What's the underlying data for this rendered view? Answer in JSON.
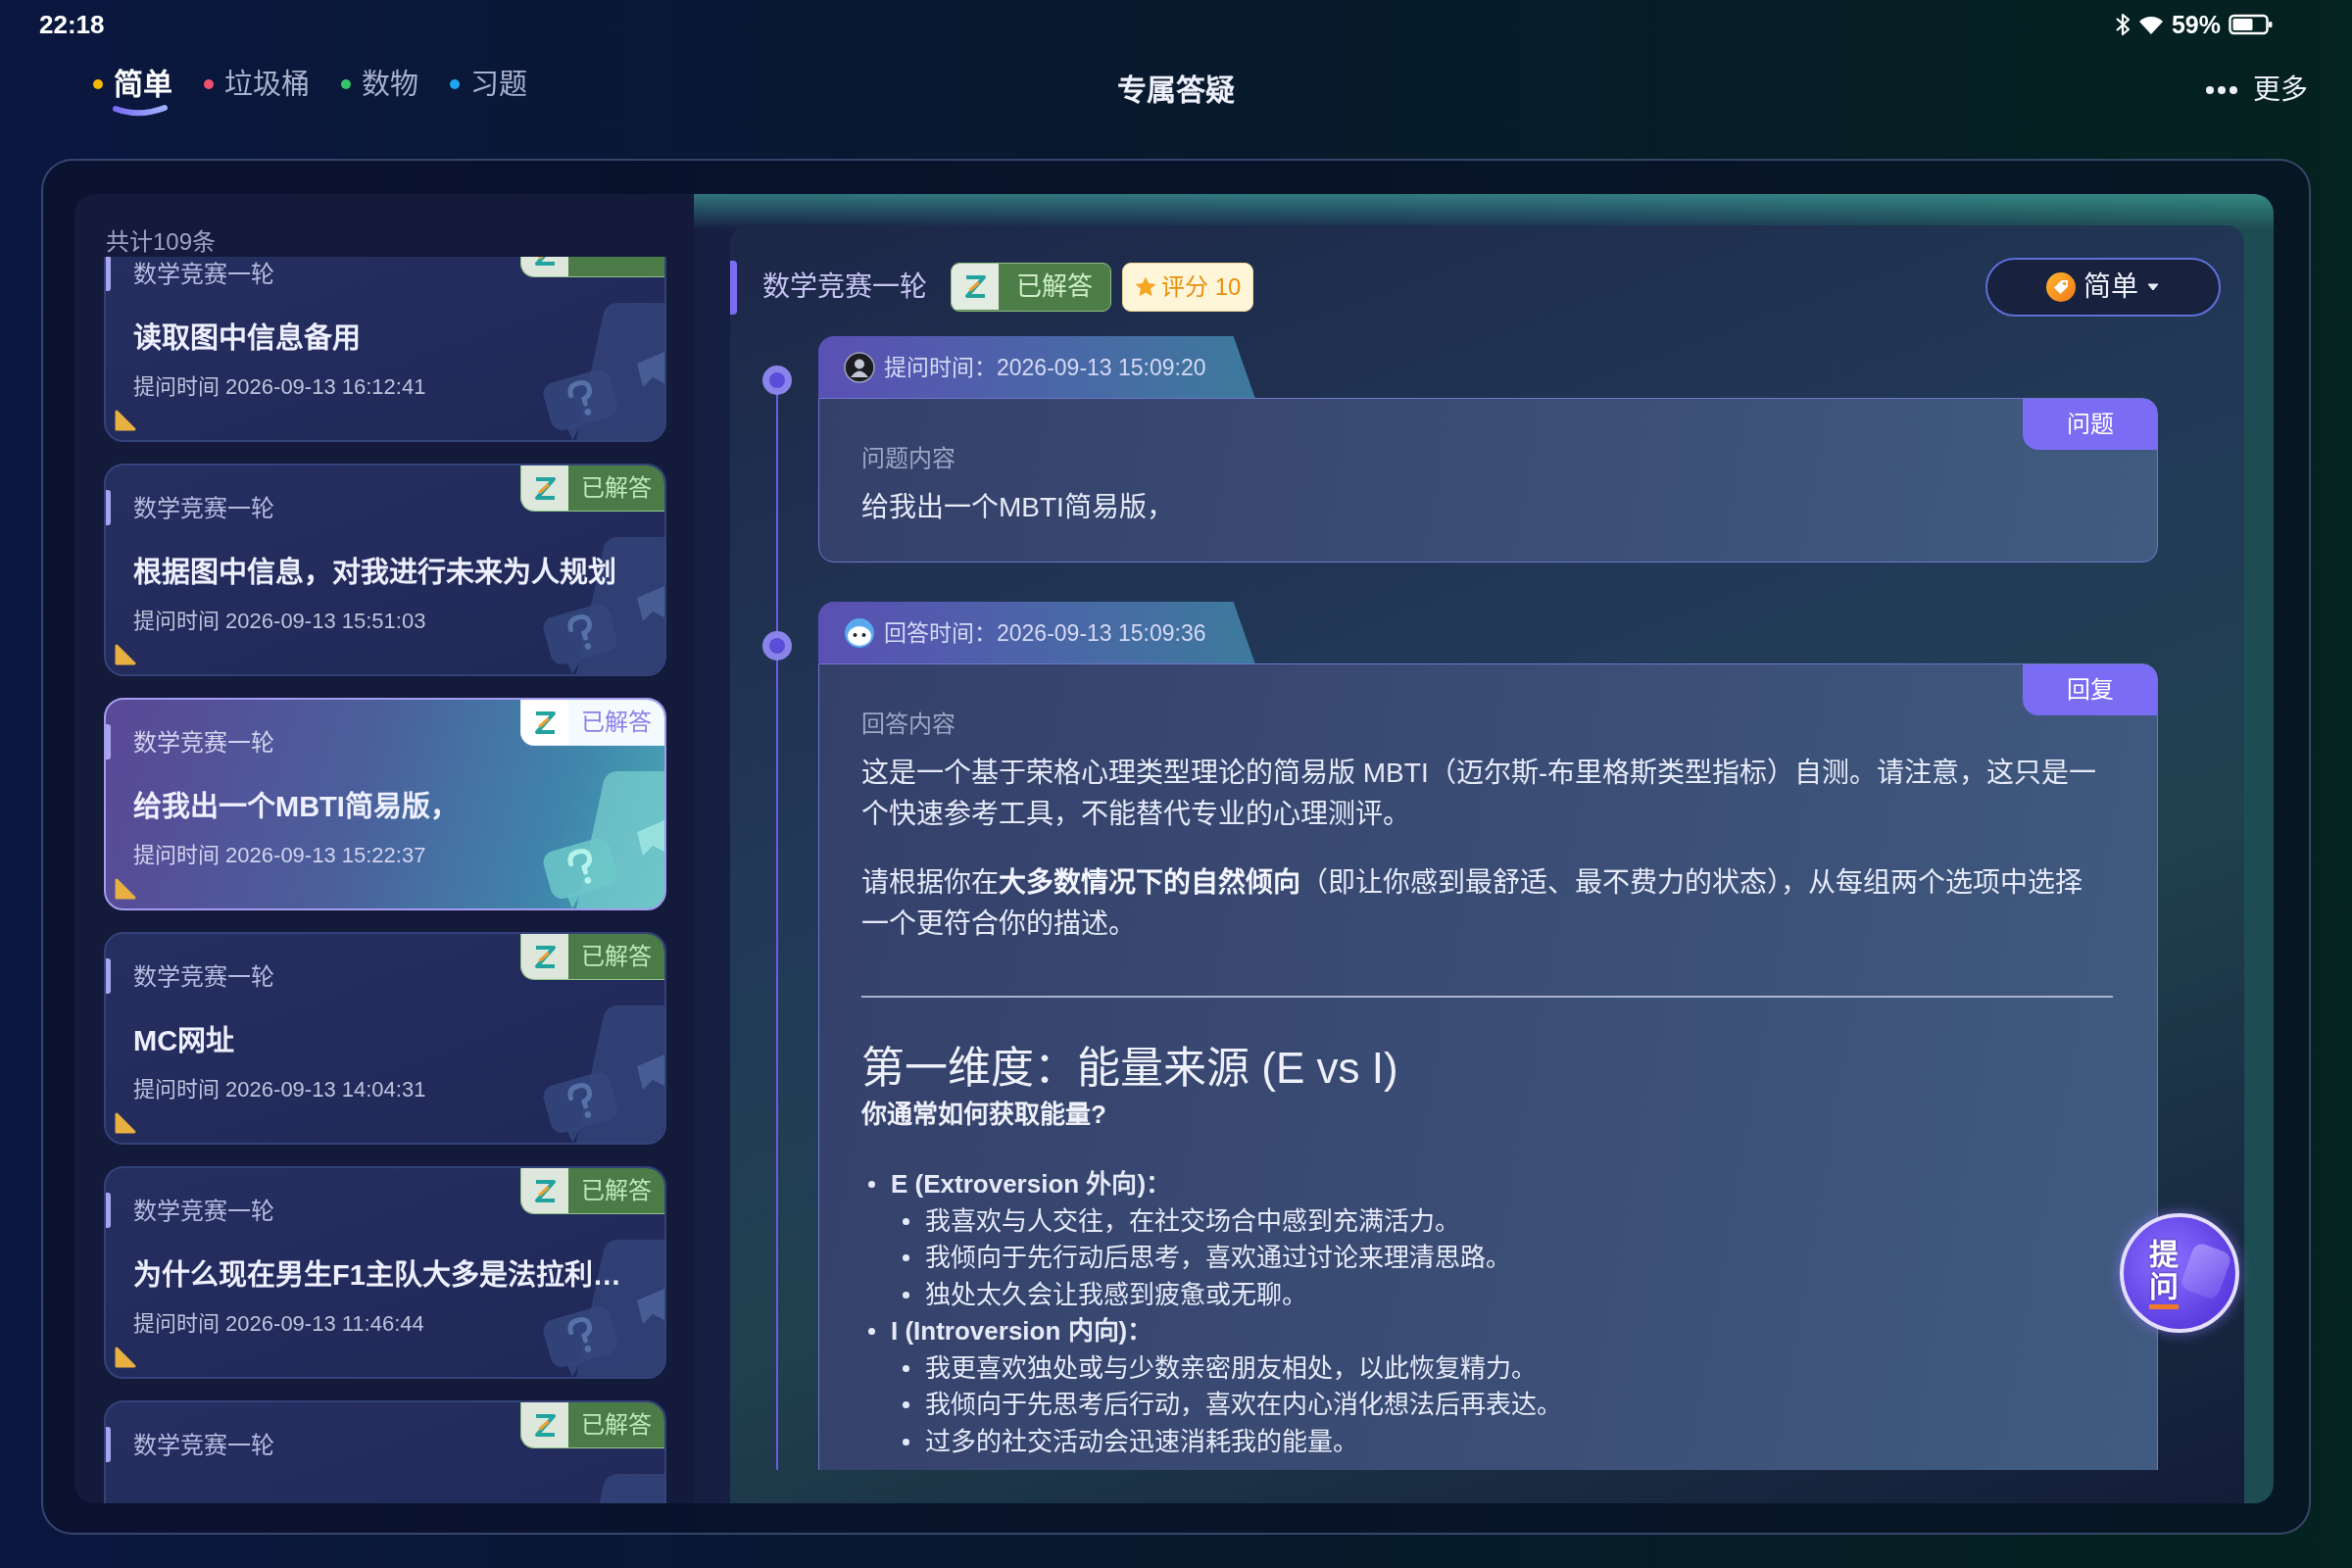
{
  "status_bar": {
    "time": "22:18",
    "battery": "59%"
  },
  "nav": {
    "tabs": [
      {
        "label": "简单",
        "color": "#f5b800",
        "selected": true
      },
      {
        "label": "垃圾桶",
        "color": "#f0506e",
        "selected": false
      },
      {
        "label": "数物",
        "color": "#36c46a",
        "selected": false
      },
      {
        "label": "习题",
        "color": "#1ea7f0",
        "selected": false
      }
    ],
    "title": "专属答疑",
    "more": "更多"
  },
  "question_list": {
    "count": "共计109条",
    "items": [
      {
        "category": "数学竞赛一轮",
        "answered": true,
        "title": "读取图中信息备用",
        "time": "提问时间 2026-09-13 16:12:41",
        "selected": false
      },
      {
        "category": "数学竞赛一轮",
        "answered": true,
        "status": "已解答",
        "title": "根据图中信息，对我进行未来为人规划",
        "time": "提问时间 2026-09-13 15:51:03",
        "selected": false
      },
      {
        "category": "数学竞赛一轮",
        "answered": true,
        "status": "已解答",
        "title": "给我出一个MBTI简易版，",
        "time": "提问时间 2026-09-13 15:22:37",
        "selected": true
      },
      {
        "category": "数学竞赛一轮",
        "answered": true,
        "status": "已解答",
        "title": "MC网址",
        "time": "提问时间 2026-09-13 14:04:31",
        "selected": false
      },
      {
        "category": "数学竞赛一轮",
        "answered": true,
        "status": "已解答",
        "title": "为什么现在男生F1主队大多是法拉利…",
        "time": "提问时间 2026-09-13 11:46:44",
        "selected": false
      },
      {
        "category": "数学竞赛一轮",
        "answered": true,
        "status": "已解答",
        "selected": false
      }
    ]
  },
  "detail": {
    "category": "数学竞赛一轮",
    "status": "已解答",
    "rating": "评分 10",
    "difficulty": "简单",
    "entries": [
      {
        "kind": "question",
        "time_label": "提问时间：2026-09-13 15:09:20",
        "tag": "问题",
        "content_label": "问题内容",
        "blocks": [
          {
            "kind": "paragraph",
            "text": "给我出一个MBTI简易版，"
          }
        ]
      },
      {
        "kind": "answer",
        "time_label": "回答时间：2026-09-13 15:09:36",
        "tag": "回复",
        "content_label": "回答内容",
        "blocks": [
          {
            "kind": "paragraph",
            "text": "这是一个基于荣格心理类型理论的简易版 MBTI（迈尔斯-布里格斯类型指标）自测。请注意，这只是一个快速参考工具，不能替代专业的心理测评。"
          },
          {
            "kind": "paragraph",
            "text": "请根据你在**大多数情况下的自然倾向**（即让你感到最舒适、最不费力的状态），从每组两个选项中选择一个更符合你的描述。"
          },
          {
            "kind": "rule"
          },
          {
            "kind": "heading",
            "text": "第一维度：能量来源 (E vs I)"
          },
          {
            "kind": "subheading",
            "text": "你通常如何获取能量?"
          },
          {
            "kind": "list",
            "items": [
              {
                "text": "E (Extroversion 外向)：",
                "children": [
                  {
                    "text": "我喜欢与人交往，在社交场合中感到充满活力。"
                  },
                  {
                    "text": "我倾向于先行动后思考，喜欢通过讨论来理清思路。"
                  },
                  {
                    "text": "独处太久会让我感到疲惫或无聊。"
                  }
                ]
              },
              {
                "text": "I (Introversion 内向)：",
                "children": [
                  {
                    "text": "我更喜欢独处或与少数亲密朋友相处，以此恢复精力。"
                  },
                  {
                    "text": "我倾向于先思考后行动，喜欢在内心消化想法后再表达。"
                  },
                  {
                    "text": "过多的社交活动会迅速消耗我的能量。"
                  }
                ]
              }
            ]
          }
        ]
      }
    ]
  },
  "ask_button": {
    "label": "提问"
  }
}
